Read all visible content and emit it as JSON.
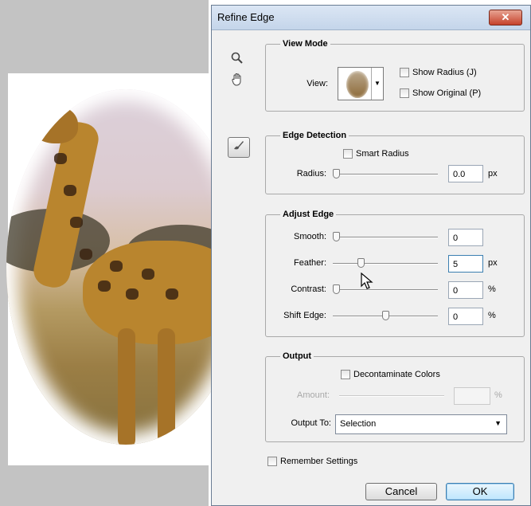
{
  "dialog": {
    "title": "Refine Edge",
    "close_label": "✕"
  },
  "view_mode": {
    "legend": "View Mode",
    "view_label": "View:",
    "show_radius_label": "Show Radius (J)",
    "show_original_label": "Show Original (P)",
    "show_radius_checked": false,
    "show_original_checked": false
  },
  "edge_detection": {
    "legend": "Edge Detection",
    "smart_radius_label": "Smart Radius",
    "smart_radius_checked": false,
    "radius_label": "Radius:",
    "radius_value": "0.0",
    "radius_unit": "px",
    "radius_fraction": 0.0
  },
  "adjust_edge": {
    "legend": "Adjust Edge",
    "smooth_label": "Smooth:",
    "smooth_value": "0",
    "smooth_fraction": 0.0,
    "feather_label": "Feather:",
    "feather_value": "5",
    "feather_unit": "px",
    "feather_fraction": 0.25,
    "contrast_label": "Contrast:",
    "contrast_value": "0",
    "contrast_unit": "%",
    "contrast_fraction": 0.0,
    "shift_label": "Shift Edge:",
    "shift_value": "0",
    "shift_unit": "%",
    "shift_fraction": 0.5
  },
  "output": {
    "legend": "Output",
    "decontaminate_label": "Decontaminate Colors",
    "decontaminate_checked": false,
    "amount_label": "Amount:",
    "amount_value": "",
    "amount_unit": "%",
    "output_to_label": "Output To:",
    "output_to_value": "Selection"
  },
  "footer": {
    "remember_label": "Remember Settings",
    "remember_checked": false,
    "cancel_label": "Cancel",
    "ok_label": "OK"
  },
  "icons": {
    "zoom": "zoom-tool-icon",
    "hand": "hand-tool-icon",
    "refine_brush": "refine-radius-brush-icon"
  }
}
